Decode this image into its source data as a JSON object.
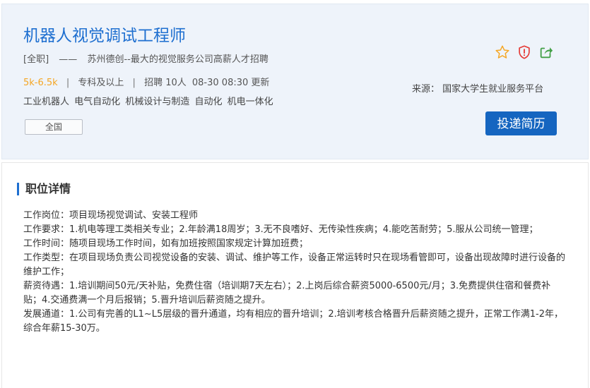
{
  "job": {
    "title": "机器人视觉调试工程师",
    "employment_type": "[全职]",
    "dash": "——",
    "company": "苏州德创--最大的视觉服务公司高薪人才招聘",
    "salary": "5k-6.5k",
    "sep": "|",
    "education": "专科及以上",
    "headcount": "招聘 10人",
    "updated": "08-30 08:30 更新",
    "tags": [
      "工业机器人",
      "电气自动化",
      "机械设计与制造",
      "自动化",
      "机电一体化"
    ],
    "region": "全国"
  },
  "actions": {
    "favorite_icon": "star-icon",
    "report_icon": "shield-warning-icon",
    "share_icon": "share-icon",
    "source": "来源：  国家大学生就业服务平台",
    "apply_label": "投递简历"
  },
  "colors": {
    "title": "#1e6fd0",
    "salary": "#f5a623",
    "star": "#f5a623",
    "report": "#e53935",
    "share": "#43a047",
    "apply_bg": "#1565c0"
  },
  "details": {
    "heading": "职位详情",
    "lines": [
      "工作岗位：项目现场视觉调试、安装工程师",
      "工作要求：1.机电等理工类相关专业；2.年龄满18周岁；3.无不良嗜好、无传染性疾病；4.能吃苦耐劳；5.服从公司统一管理；",
      "工作时间：随项目现场工作时间，如有加班按照国家规定计算加班费；",
      "工作类型：在项目现场负责公司视觉设备的安装、调试、维护等工作，设备正常运转时只在现场看管即可，设备出现故障时进行设备的维护工作；",
      "薪资待遇：1.培训期间50元/天补贴，免费住宿（培训期7天左右）；2.上岗后综合薪资5000-6500元/月；3.免费提供住宿和餐费补贴；4.交通费满一个月后报销；5.晋升培训后薪资随之提升。",
      "发展通道：1.公司有完善的L1~L5层级的晋升通道，均有相应的晋升培训；2.培训考核合格晋升后薪资随之提升，正常工作满1-2年，综合年薪15-30万。"
    ]
  }
}
